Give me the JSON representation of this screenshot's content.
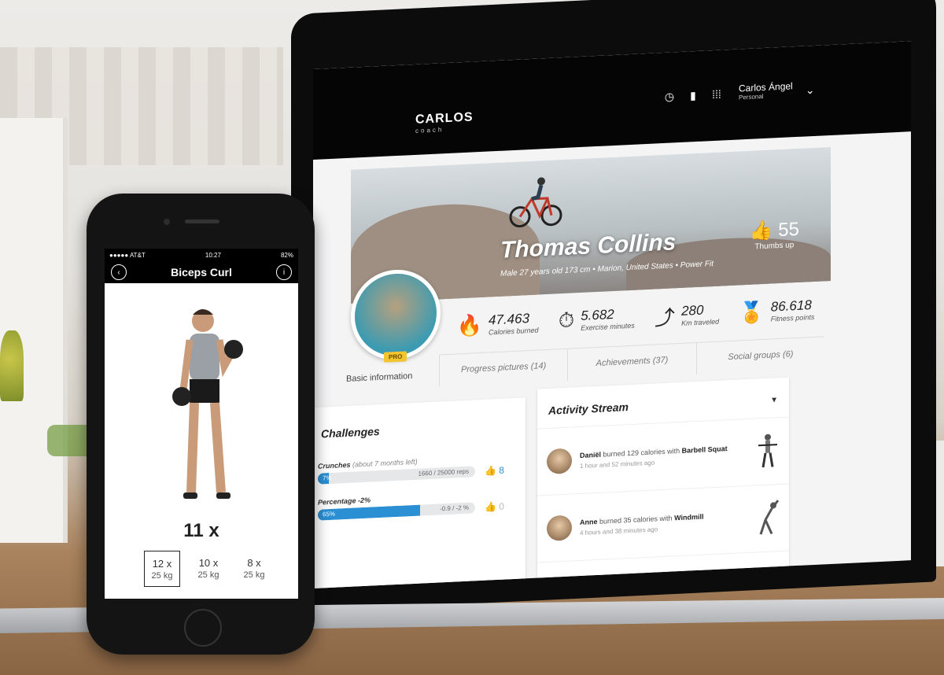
{
  "laptop": {
    "brand": {
      "name": "CARLOS",
      "tagline": "coach"
    },
    "header": {
      "user_name": "Carlos Ángel",
      "user_role": "Personal"
    },
    "profile": {
      "name": "Thomas Collins",
      "meta": "Male 27 years old 173 cm  •  Marion, United States  •  Power Fit",
      "badge": "PRO",
      "thumbs_count": "55",
      "thumbs_label": "Thumbs up"
    },
    "stats": [
      {
        "value": "47.463",
        "label": "Calories burned",
        "icon": "flame-icon"
      },
      {
        "value": "5.682",
        "label": "Exercise minutes",
        "icon": "stopwatch-icon"
      },
      {
        "value": "280",
        "label": "Km traveled",
        "icon": "route-icon"
      },
      {
        "value": "86.618",
        "label": "Fitness points",
        "icon": "medal-icon"
      }
    ],
    "tabs": {
      "basic": "Basic information",
      "progress": "Progress pictures  (14)",
      "achievements": "Achievements  (37)",
      "social": "Social groups  (6)"
    },
    "challenges": {
      "title": "Challenges",
      "items": [
        {
          "name": "Crunches",
          "note": "(about 7 months left)",
          "percent": "7%",
          "progress": 0.07,
          "detail": "1660 / 25000 reps",
          "likes": "8"
        },
        {
          "name": "Percentage -2%",
          "note": "",
          "percent": "65%",
          "progress": 0.65,
          "detail": "-0.9 / -2 %",
          "likes": "0"
        }
      ]
    },
    "activity": {
      "title": "Activity Stream",
      "items": [
        {
          "user": "Daniël",
          "text": " burned 129 calories with ",
          "exercise": "Barbell Squat",
          "time": "1 hour and 52 minutes ago"
        },
        {
          "user": "Anne",
          "text": " burned 35 calories with ",
          "exercise": "Windmill",
          "time": "4 hours and 38 minutes ago"
        }
      ]
    }
  },
  "phone": {
    "status": {
      "carrier": "●●●●● AT&T",
      "time": "10:27",
      "battery": "82%"
    },
    "title": "Biceps Curl",
    "reps": "11 x",
    "sets": [
      {
        "reps": "12 x",
        "weight": "25 kg",
        "active": true
      },
      {
        "reps": "10 x",
        "weight": "25 kg",
        "active": false
      },
      {
        "reps": "8 x",
        "weight": "25 kg",
        "active": false
      }
    ]
  },
  "colors": {
    "accent": "#2a8fd3",
    "pro_badge": "#f2c430",
    "topbar": "#050505"
  }
}
